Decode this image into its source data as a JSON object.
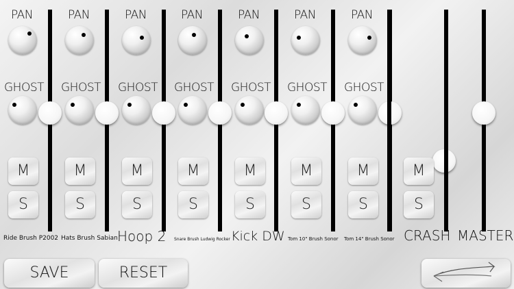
{
  "channels": [
    {
      "pan_label": "PAN",
      "ghost_label": "GHOST",
      "mute_label": "M",
      "solo_label": "S",
      "name": "Ride Brush P2002"
    },
    {
      "pan_label": "PAN",
      "ghost_label": "GHOST",
      "mute_label": "M",
      "solo_label": "S",
      "name": "Hats Brush Sabian"
    },
    {
      "pan_label": "PAN",
      "ghost_label": "GHOST",
      "mute_label": "M",
      "solo_label": "S",
      "name": "Hoop 2"
    },
    {
      "pan_label": "PAN",
      "ghost_label": "GHOST",
      "mute_label": "M",
      "solo_label": "S",
      "name": "Snare Brush Ludwig Rocker"
    },
    {
      "pan_label": "PAN",
      "ghost_label": "GHOST",
      "mute_label": "M",
      "solo_label": "S",
      "name": "Kick DW"
    },
    {
      "pan_label": "PAN",
      "ghost_label": "GHOST",
      "mute_label": "M",
      "solo_label": "S",
      "name": "Tom 10\" Brush Sonor"
    },
    {
      "pan_label": "PAN",
      "ghost_label": "GHOST",
      "mute_label": "M",
      "solo_label": "S",
      "name": "Tom 14\" Brush Sonor"
    }
  ],
  "crash": {
    "mute_label": "M",
    "solo_label": "S",
    "name": "CRASH"
  },
  "master": {
    "name": "MASTER"
  },
  "buttons": {
    "save": "SAVE",
    "reset": "RESET"
  },
  "icons": {
    "back": "curved-arrow-icon",
    "pan_knob": "knob-icon"
  }
}
